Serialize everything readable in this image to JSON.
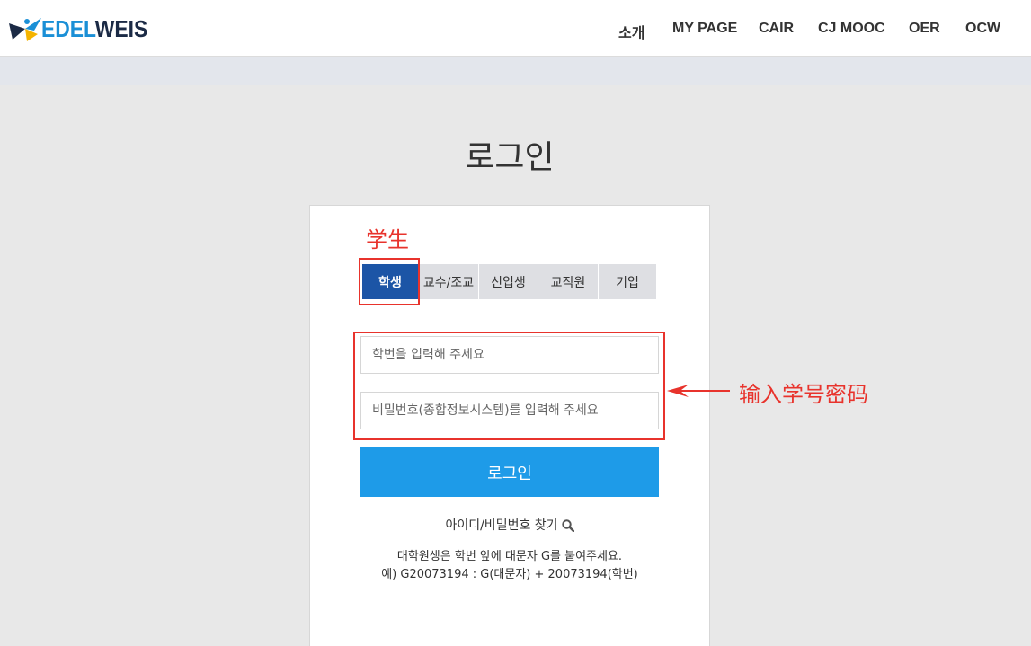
{
  "header": {
    "logo_text_a": "EDEL",
    "logo_text_b": "WEIS",
    "nav": [
      "소개",
      "MY PAGE",
      "CAIR",
      "CJ MOOC",
      "OER",
      "OCW"
    ]
  },
  "page_title": "로그인",
  "tabs": [
    {
      "label": "학생",
      "active": true
    },
    {
      "label": "교수/조교",
      "active": false
    },
    {
      "label": "신입생",
      "active": false
    },
    {
      "label": "교직원",
      "active": false
    },
    {
      "label": "기업",
      "active": false
    }
  ],
  "form": {
    "id_placeholder": "학번을 입력해 주세요",
    "pw_placeholder": "비밀번호(종합정보시스템)를 입력해 주세요",
    "login_label": "로그인"
  },
  "find_link": "아이디/비밀번호 찾기",
  "notes": [
    "대학원생은 학번 앞에 대문자 G를 붙여주세요.",
    "예) G20073194 : G(대문자) + 20073194(학번)"
  ],
  "annotations": {
    "student": "学生",
    "input_hint": "输入学号密码",
    "color": "#e8332c"
  },
  "colors": {
    "brand_blue": "#1a8fd6",
    "active_tab": "#1c55a6",
    "login_button": "#1e9be8"
  },
  "icons": {
    "logo": "edelweis-logo-icon",
    "find": "search-icon"
  }
}
